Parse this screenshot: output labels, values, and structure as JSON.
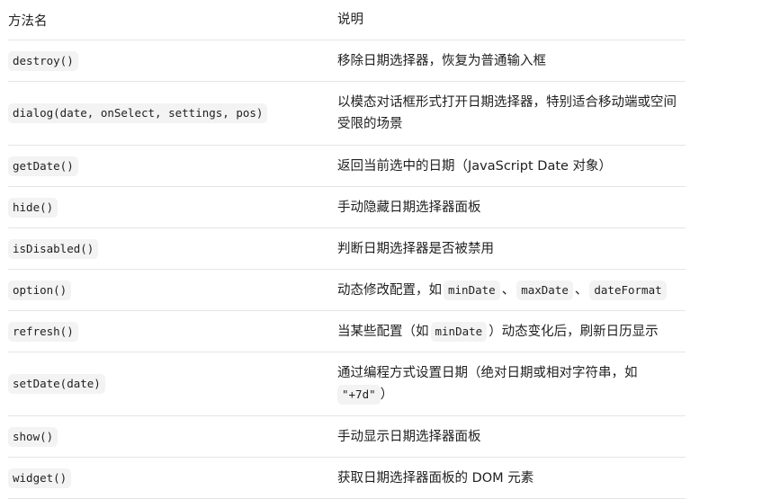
{
  "header": {
    "method": "方法名",
    "description": "说明"
  },
  "rows": [
    {
      "method": "destroy()",
      "description": "移除日期选择器，恢复为普通输入框"
    },
    {
      "method": "dialog(date, onSelect, settings, pos)",
      "description": "以模态对话框形式打开日期选择器，特别适合移动端或空间受限的场景"
    },
    {
      "method": "getDate()",
      "description": "返回当前选中的日期（JavaScript Date 对象）"
    },
    {
      "method": "hide()",
      "description": "手动隐藏日期选择器面板"
    },
    {
      "method": "isDisabled()",
      "description": "判断日期选择器是否被禁用"
    },
    {
      "method": "option()",
      "description_parts": {
        "prefix": "动态修改配置，如",
        "code1": "minDate",
        "sep1": "、",
        "code2": "maxDate",
        "sep2": "、",
        "code3": "dateFormat"
      }
    },
    {
      "method": "refresh()",
      "description_parts": {
        "prefix": "当某些配置（如",
        "code1": "minDate",
        "suffix": "）动态变化后，刷新日历显示"
      }
    },
    {
      "method": "setDate(date)",
      "description_parts": {
        "prefix": "通过编程方式设置日期（绝对日期或相对字符串，如",
        "code1": "\"+7d\"",
        "suffix": "）"
      }
    },
    {
      "method": "show()",
      "description": "手动显示日期选择器面板"
    },
    {
      "method": "widget()",
      "description": "获取日期选择器面板的 DOM 元素"
    }
  ]
}
